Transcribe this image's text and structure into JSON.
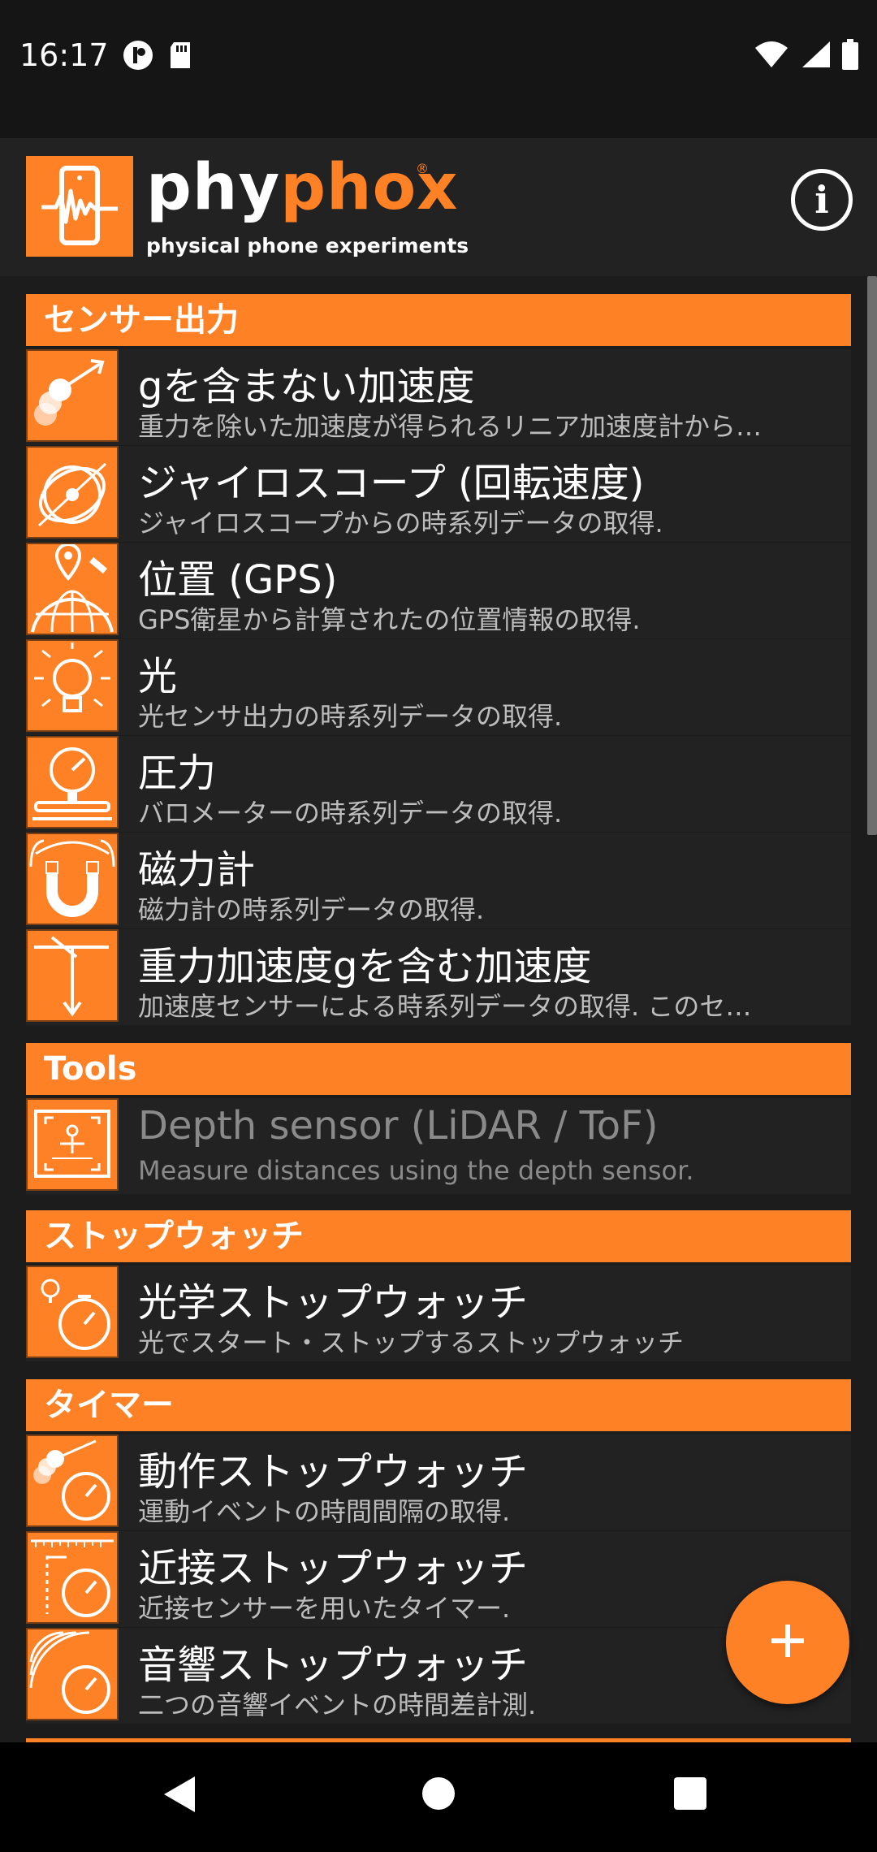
{
  "status": {
    "time": "16:17"
  },
  "app": {
    "logo_word_a": "phy",
    "logo_word_b": "phox",
    "logo_reg": "®",
    "logo_sub": "physical phone experiments",
    "info_label": "i"
  },
  "categories": [
    {
      "name": "センサー出力",
      "items": [
        {
          "title": "gを含まない加速度",
          "desc": "重力を除いた加速度が得られるリニア加速度計から…",
          "icon": "linear-acceleration-icon"
        },
        {
          "title": "ジャイロスコープ (回転速度)",
          "desc": "ジャイロスコープからの時系列データの取得.",
          "icon": "gyroscope-icon"
        },
        {
          "title": "位置 (GPS)",
          "desc": "GPS衛星から計算されたの位置情報の取得.",
          "icon": "gps-location-icon"
        },
        {
          "title": "光",
          "desc": "光センサ出力の時系列データの取得.",
          "icon": "light-bulb-icon"
        },
        {
          "title": "圧力",
          "desc": "バロメーターの時系列データの取得.",
          "icon": "pressure-gauge-icon"
        },
        {
          "title": "磁力計",
          "desc": "磁力計の時系列データの取得.",
          "icon": "magnet-icon"
        },
        {
          "title": "重力加速度gを含む加速度",
          "desc": "加速度センサーによる時系列データの取得. このセ…",
          "icon": "acceleration-axes-icon"
        }
      ]
    },
    {
      "name": "Tools",
      "items": [
        {
          "title": "Depth sensor (LiDAR / ToF)",
          "desc": "Measure distances using the depth sensor.",
          "icon": "depth-sensor-icon"
        }
      ]
    },
    {
      "name": "ストップウォッチ",
      "items": [
        {
          "title": "光学ストップウォッチ",
          "desc": "光でスタート・ストップするストップウォッチ",
          "icon": "optical-stopwatch-icon"
        }
      ]
    },
    {
      "name": "タイマー",
      "items": [
        {
          "title": "動作ストップウォッチ",
          "desc": "運動イベントの時間間隔の取得.",
          "icon": "motion-stopwatch-icon"
        },
        {
          "title": "近接ストップウォッチ",
          "desc": "近接センサーを用いたタイマー.",
          "icon": "proximity-stopwatch-icon"
        },
        {
          "title": "音響ストップウォッチ",
          "desc": "二つの音響イベントの時間差計測.",
          "icon": "acoustic-stopwatch-icon"
        }
      ]
    }
  ],
  "fab_label": "+",
  "colors": {
    "accent": "#fe8125",
    "item_bg": "#222222",
    "background": "#1c1c1c"
  }
}
